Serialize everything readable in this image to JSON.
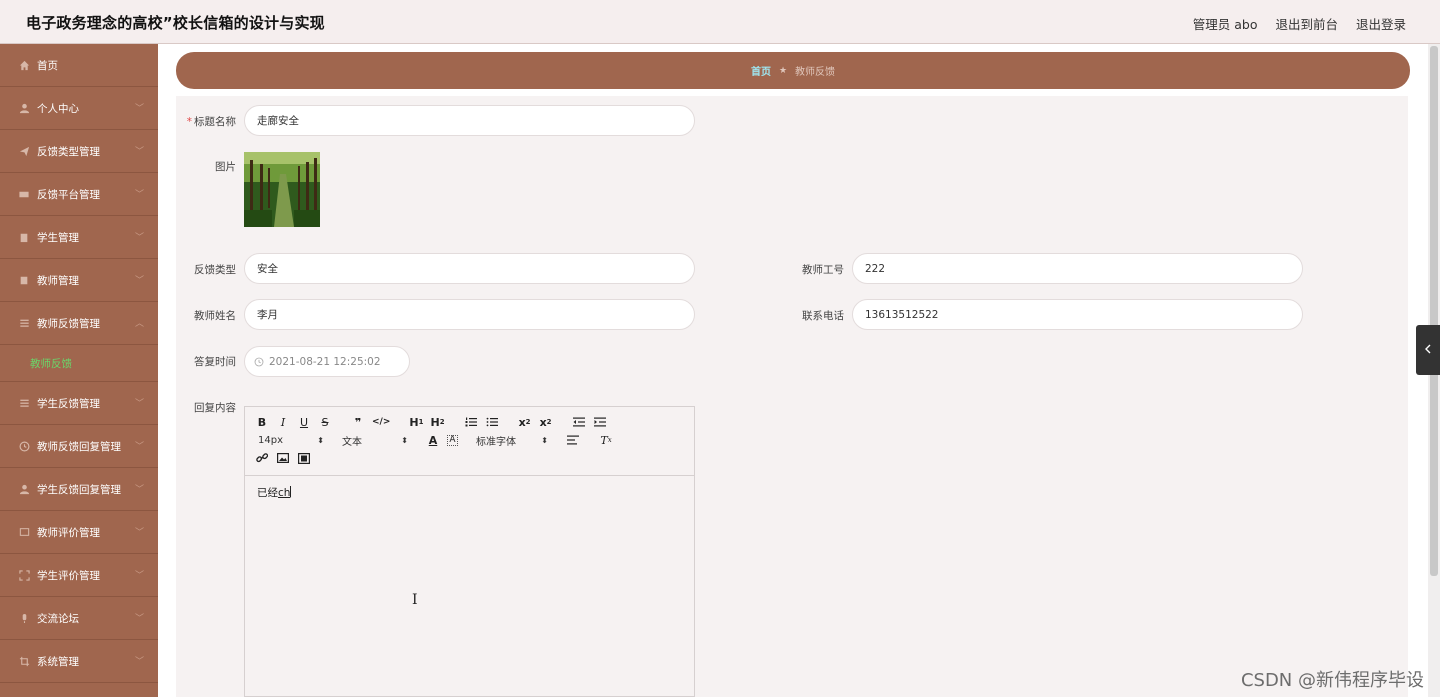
{
  "header": {
    "title": "电子政务理念的高校”校长信箱的设计与实现",
    "links": [
      "管理员 abo",
      "退出到前台",
      "退出登录"
    ]
  },
  "sidebar": {
    "items": [
      {
        "label": "首页",
        "icon": "home-icon",
        "arrow": false
      },
      {
        "label": "个人中心",
        "icon": "user-icon",
        "arrow": true
      },
      {
        "label": "反馈类型管理",
        "icon": "send-icon",
        "arrow": true
      },
      {
        "label": "反馈平台管理",
        "icon": "ticket-icon",
        "arrow": true
      },
      {
        "label": "学生管理",
        "icon": "clipboard-icon",
        "arrow": true
      },
      {
        "label": "教师管理",
        "icon": "book-icon",
        "arrow": true
      },
      {
        "label": "教师反馈管理",
        "icon": "list-icon",
        "arrow": true,
        "expanded": true
      },
      {
        "label": "学生反馈管理",
        "icon": "list-icon",
        "arrow": true
      },
      {
        "label": "教师反馈回复管理",
        "icon": "clock-icon",
        "arrow": true
      },
      {
        "label": "学生反馈回复管理",
        "icon": "user-icon",
        "arrow": true
      },
      {
        "label": "教师评价管理",
        "icon": "message-icon",
        "arrow": true
      },
      {
        "label": "学生评价管理",
        "icon": "expand-icon",
        "arrow": true
      },
      {
        "label": "交流论坛",
        "icon": "mic-icon",
        "arrow": true
      },
      {
        "label": "系统管理",
        "icon": "crop-icon",
        "arrow": true
      }
    ],
    "active_sub": "教师反馈"
  },
  "breadcrumb": {
    "home": "首页",
    "current": "教师反馈"
  },
  "form": {
    "title_label": "标题名称",
    "title_value": "走廊安全",
    "image_label": "图片",
    "type_label": "反馈类型",
    "type_value": "安全",
    "teacher_no_label": "教师工号",
    "teacher_no_value": "222",
    "teacher_name_label": "教师姓名",
    "teacher_name_value": "李月",
    "phone_label": "联系电话",
    "phone_value": "13613512522",
    "reply_time_label": "答复时间",
    "reply_time_value": "2021-08-21 12:25:02",
    "reply_content_label": "回复内容"
  },
  "editor": {
    "font_size": "14px",
    "text_style": "文本",
    "font_family": "标准字体",
    "content_prefix": "已经",
    "content_typing": "ch"
  },
  "watermark": "CSDN @新伟程序毕设",
  "colors": {
    "sidebar": "#a0664e",
    "active_sub": "#6ad66a",
    "crumb_home": "#9fe6f0"
  }
}
